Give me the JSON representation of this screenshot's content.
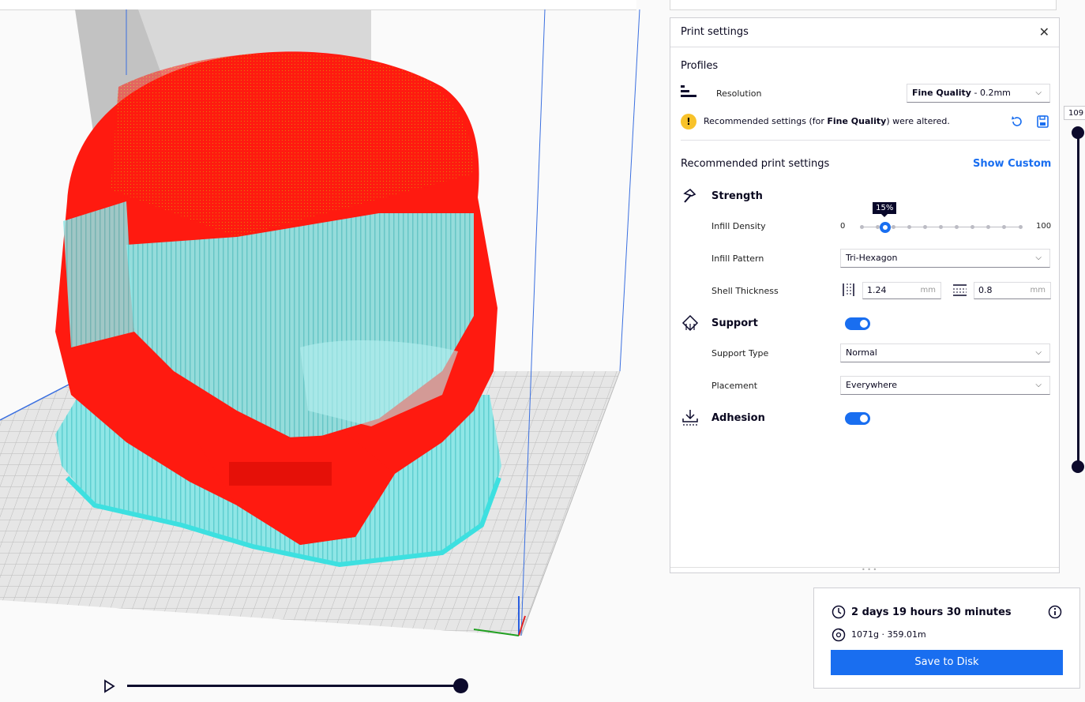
{
  "print_settings": {
    "title": "Print settings",
    "profiles_label": "Profiles",
    "resolution_label": "Resolution",
    "resolution_value_bold": "Fine Quality",
    "resolution_value_rest": " - 0.2mm",
    "warning_pre": "Recommended settings (for ",
    "warning_bold": "Fine Quality",
    "warning_post": ") were altered.",
    "recommended_label": "Recommended print settings",
    "show_custom": "Show Custom",
    "strength": {
      "title": "Strength",
      "infill_density_label": "Infill Density",
      "infill_density_value": 15,
      "infill_density_tip": "15%",
      "infill_min": "0",
      "infill_max": "100",
      "infill_pattern_label": "Infill Pattern",
      "infill_pattern_value": "Tri-Hexagon",
      "shell_thickness_label": "Shell Thickness",
      "wall_value": "1.24",
      "top_bottom_value": "0.8",
      "unit": "mm"
    },
    "support": {
      "title": "Support",
      "enabled": true,
      "type_label": "Support Type",
      "type_value": "Normal",
      "placement_label": "Placement",
      "placement_value": "Everywhere"
    },
    "adhesion": {
      "title": "Adhesion",
      "enabled": true
    }
  },
  "estimate": {
    "time": "2 days 19 hours 30 minutes",
    "material": "1071g · 359.01m",
    "save_label": "Save to Disk"
  },
  "layer_slider": {
    "value": "109"
  },
  "colors": {
    "accent": "#196ef0",
    "model_red": "#ff1a10",
    "support_cyan": "#8fe6e6",
    "dark": "#0c0a2c"
  }
}
